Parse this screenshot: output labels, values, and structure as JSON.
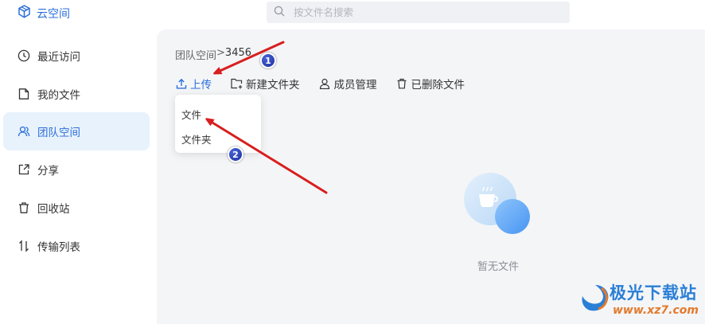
{
  "header": {
    "app_title": "云空间",
    "search_placeholder": "按文件名搜索"
  },
  "sidebar": {
    "items": [
      {
        "label": "最近访问",
        "icon": "clock-icon"
      },
      {
        "label": "我的文件",
        "icon": "document-icon"
      },
      {
        "label": "团队空间",
        "icon": "team-icon",
        "active": true
      },
      {
        "label": "分享",
        "icon": "share-icon"
      },
      {
        "label": "回收站",
        "icon": "trash-icon"
      },
      {
        "label": "传输列表",
        "icon": "transfer-icon"
      }
    ]
  },
  "breadcrumb": {
    "root": "团队空间",
    "separator": ">",
    "current": "3456"
  },
  "toolbar": {
    "upload_label": "上传",
    "new_folder_label": "新建文件夹",
    "members_label": "成员管理",
    "deleted_label": "已删除文件"
  },
  "dropdown": {
    "items": [
      "文件",
      "文件夹"
    ]
  },
  "empty_state": {
    "text": "暂无文件"
  },
  "annotations": {
    "badge1": "1",
    "badge2": "2",
    "arrow_color": "#d81e1e"
  },
  "watermark": {
    "title": "极光下载站",
    "url": "www.xz7.com"
  },
  "colors": {
    "accent": "#2c6fdb",
    "active_bg": "#e8f2fc",
    "main_bg": "#f4f5f7"
  }
}
